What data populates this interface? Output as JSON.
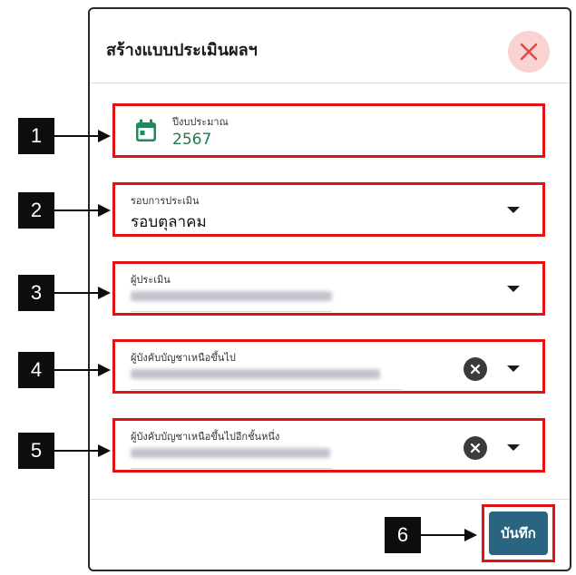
{
  "dialog": {
    "title": "สร้างแบบประเมินผลฯ",
    "close_icon": "close-icon",
    "save_label": "บันทึก"
  },
  "fields": [
    {
      "label": "ปีงบประมาณ",
      "value": "2567",
      "icon": "calendar-icon"
    },
    {
      "label": "รอบการประเมิน",
      "value": "รอบตุลาคม",
      "icon": "chevron-down-icon"
    },
    {
      "label": "ผู้ประเมิน",
      "icon": "chevron-down-icon"
    },
    {
      "label": "ผู้บังคับบัญชาเหนือขึ้นไป",
      "icon": "chevron-down-icon",
      "clear_icon": "clear-icon"
    },
    {
      "label": "ผู้บังคับบัญชาเหนือขึ้นไปอีกชั้นหนึ่ง",
      "icon": "chevron-down-icon",
      "clear_icon": "clear-icon"
    }
  ],
  "markers": [
    "1",
    "2",
    "3",
    "4",
    "5",
    "6"
  ],
  "colors": {
    "accent_green": "#1f8a5b",
    "save_button": "#2a6480",
    "close_bg": "#fbd2d2",
    "close_x": "#e04848",
    "highlight": "#e01414"
  }
}
